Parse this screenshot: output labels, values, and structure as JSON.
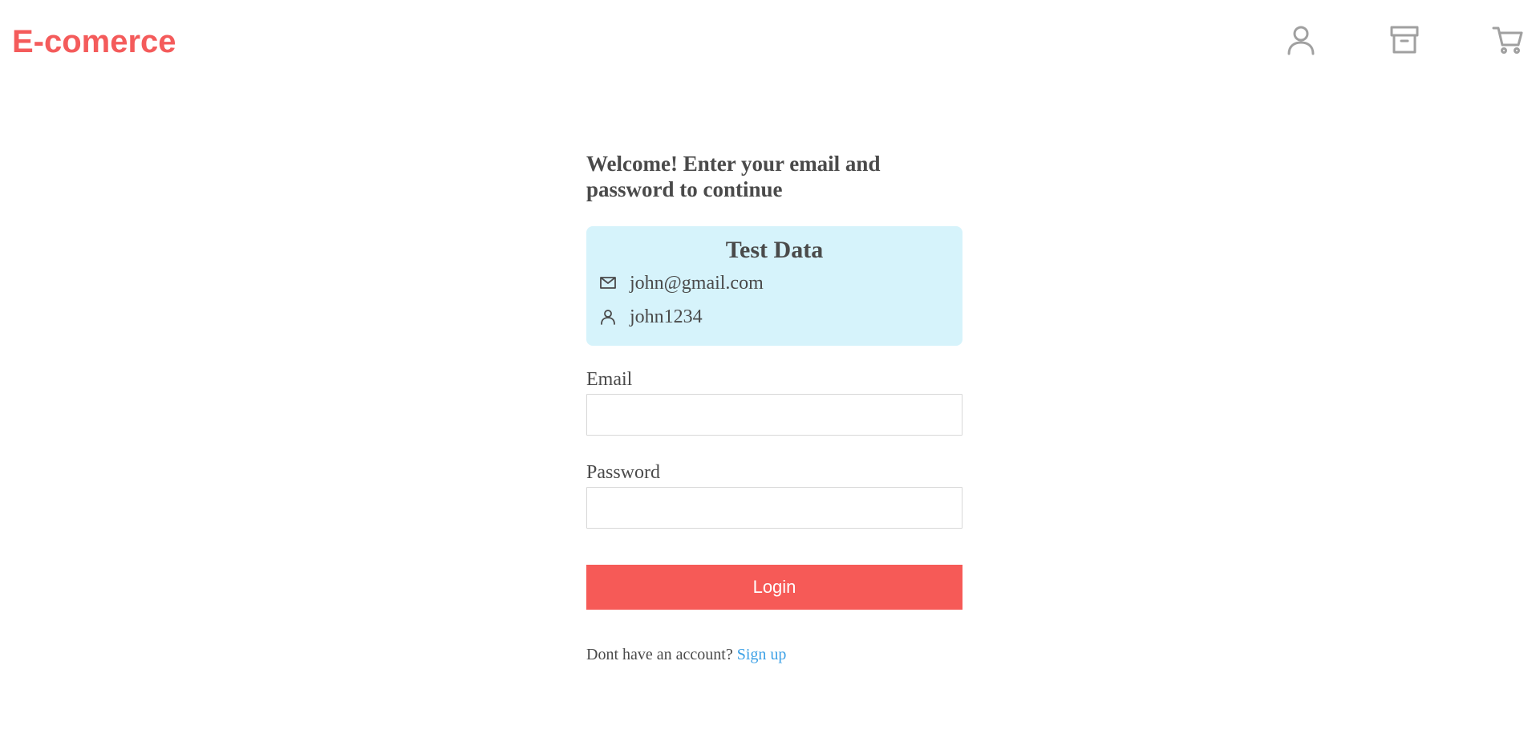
{
  "header": {
    "brand": "E-comerce",
    "icons": [
      "user-icon",
      "archive-icon",
      "cart-icon"
    ],
    "brand_color": "#f45b5b",
    "icon_color": "#a0a0a0"
  },
  "login": {
    "welcome": "Welcome! Enter your email and password to continue",
    "test_data": {
      "title": "Test Data",
      "email": "john@gmail.com",
      "password": "john1234",
      "background": "#d6f3fb"
    },
    "email_label": "Email",
    "email_value": "",
    "password_label": "Password",
    "password_value": "",
    "login_button": "Login",
    "login_button_color": "#f65a57",
    "no_account_text": "Dont have an account?",
    "signup_link": "Sign up",
    "link_color": "#3ba0e6"
  }
}
